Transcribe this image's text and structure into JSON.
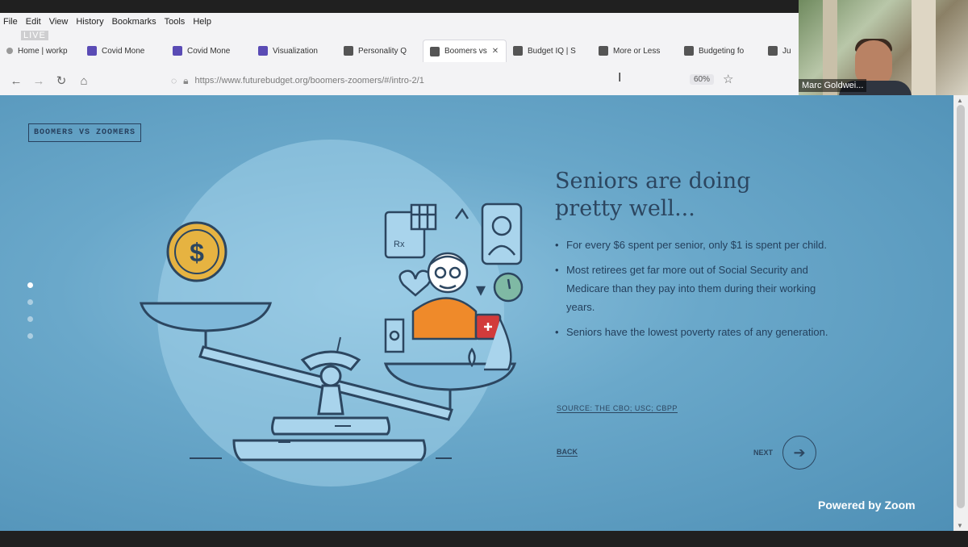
{
  "menu": [
    "File",
    "Edit",
    "View",
    "History",
    "Bookmarks",
    "Tools",
    "Help"
  ],
  "live_badge": "LIVE",
  "tabs": [
    {
      "label": "Home | workp",
      "color": "#888888",
      "active": false
    },
    {
      "label": "Covid Mone",
      "color": "#5a4bb5",
      "active": false
    },
    {
      "label": "Covid Mone",
      "color": "#5a4bb5",
      "active": false
    },
    {
      "label": "Visualization",
      "color": "#5a4bb5",
      "active": false
    },
    {
      "label": "Personality Q",
      "color": "#555555",
      "active": false
    },
    {
      "label": "Boomers vs",
      "color": "#555555",
      "active": true
    },
    {
      "label": "Budget IQ | S",
      "color": "#555555",
      "active": false
    },
    {
      "label": "More or Less",
      "color": "#555555",
      "active": false
    },
    {
      "label": "Budgeting fo",
      "color": "#555555",
      "active": false
    },
    {
      "label": "Ju",
      "color": "#555555",
      "active": false
    }
  ],
  "url": "https://www.futurebudget.org/boomers-zoomers/#/intro-2/1",
  "zoom_level": "60%",
  "webcam": {
    "name": "Marc Goldwei..."
  },
  "page": {
    "badge": "BOOMERS VS ZOOMERS",
    "heading_line1": "Seniors are doing",
    "heading_line2": "pretty well...",
    "bullets": [
      "For every $6 spent per senior, only $1 is spent per child.",
      "Most retirees get far more out of Social Security and Medicare than they pay into them during their working years.",
      "Seniors have the lowest poverty rates of any generation."
    ],
    "source_label": "SOURCE: THE CBO; USC; CBPP",
    "back_label": "BACK",
    "next_label": "NEXT",
    "next_icon": "arrow-right-icon"
  },
  "watermark": "Powered by Zoom",
  "colors": {
    "accent": "#2c4660",
    "background": "#6aa8ca",
    "coin": "#e6b341",
    "shirt": "#ef8a2a"
  }
}
